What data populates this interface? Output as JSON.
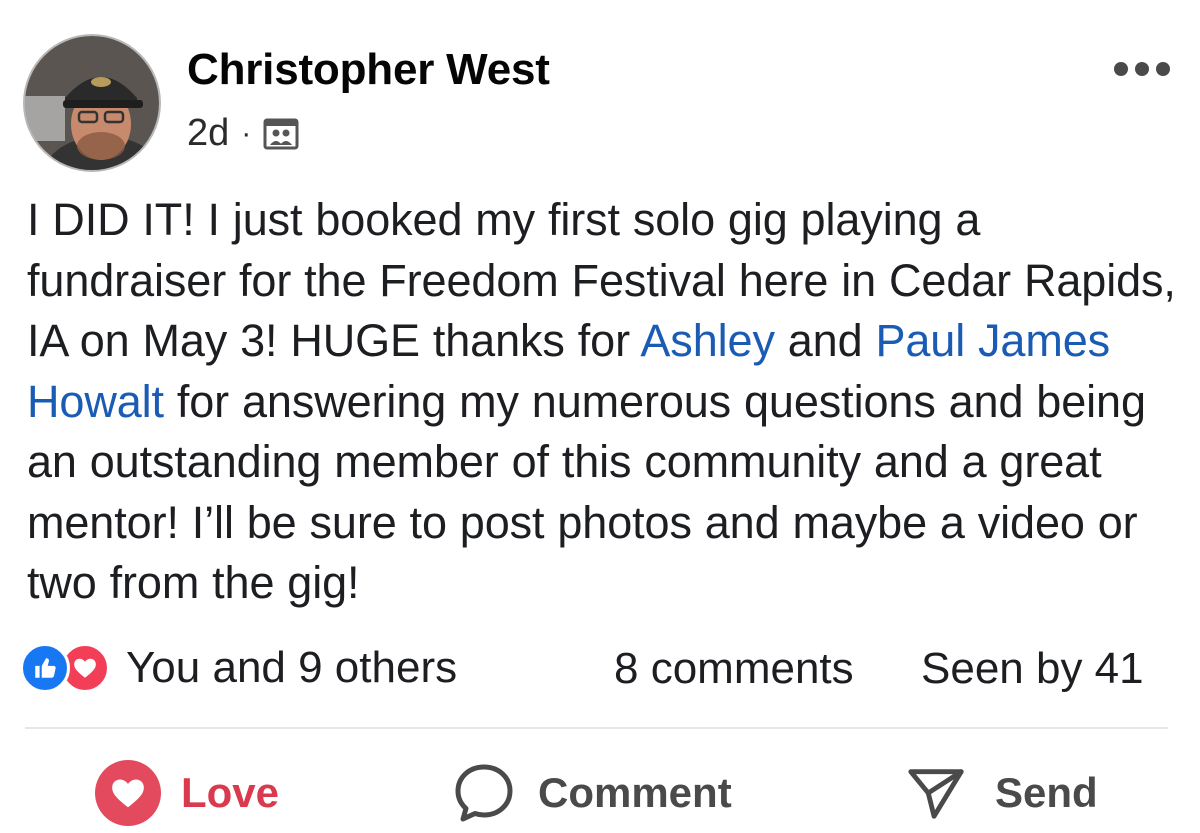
{
  "post": {
    "author": "Christopher West",
    "time": "2d",
    "separator": "·",
    "audience_icon": "group-icon",
    "more_icon": "more-icon",
    "body": {
      "part1": "I DID IT! I just booked my first solo gig playing a fundraiser for the Freedom  Festival here in Cedar Rapids, IA on May 3! HUGE thanks for ",
      "mention1": "Ashley",
      "part2": " and ",
      "mention2": "Paul James Howalt",
      "part3": " for answering my numerous questions and being an outstanding member of this community and a great mentor! I’ll be sure to post photos and maybe a video or two from the gig!"
    }
  },
  "stats": {
    "reactions_text": "You and 9 others",
    "comments": "8 comments",
    "seen_by": "Seen by 41"
  },
  "actions": {
    "love": "Love",
    "comment": "Comment",
    "send": "Send"
  },
  "colors": {
    "mention": "#1a5bb4",
    "love": "#d93a4e",
    "like": "#1877f2"
  }
}
